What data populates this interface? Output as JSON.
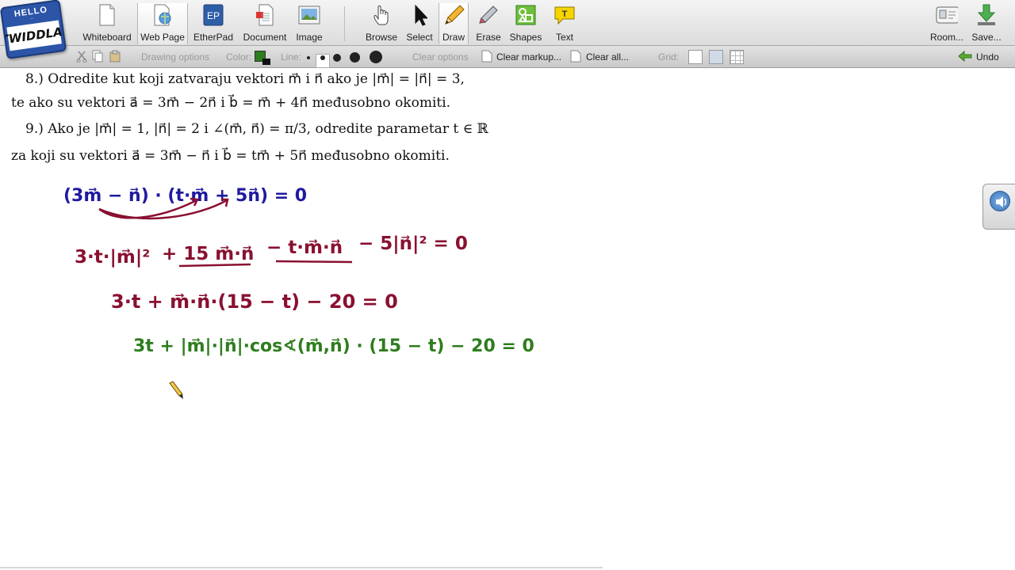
{
  "logo": {
    "hello": "HELLO",
    "name": "TWIDDLA!"
  },
  "toolbar": {
    "tools": [
      {
        "label": "Whiteboard",
        "icon": "whiteboard-icon"
      },
      {
        "label": "Web Page",
        "icon": "web-page-icon"
      },
      {
        "label": "EtherPad",
        "icon": "etherpad-icon",
        "badge": "EP"
      },
      {
        "label": "Document",
        "icon": "document-icon"
      },
      {
        "label": "Image",
        "icon": "image-icon"
      },
      {
        "label": "Browse",
        "icon": "hand-icon"
      },
      {
        "label": "Select",
        "icon": "arrow-cursor-icon"
      },
      {
        "label": "Draw",
        "icon": "pencil-icon"
      },
      {
        "label": "Erase",
        "icon": "eraser-icon"
      },
      {
        "label": "Shapes",
        "icon": "shapes-icon"
      },
      {
        "label": "Text",
        "icon": "text-icon",
        "badge": "T"
      },
      {
        "label": "Room...",
        "icon": "room-icon"
      },
      {
        "label": "Save...",
        "icon": "save-icon"
      }
    ],
    "active_tools": [
      "Web Page",
      "Draw"
    ]
  },
  "options": {
    "drawing_options": "Drawing options",
    "color_label": "Color:",
    "current_color": "#2e7d1e",
    "line_label": "Line:",
    "clear_options": "Clear options",
    "clear_markup": "Clear markup...",
    "clear_all": "Clear all...",
    "grid_label": "Grid:",
    "undo": "Undo"
  },
  "problems": {
    "p8_line1": "8.)  Odredite kut koji zatvaraju vektori m⃗ i n⃗ ako je |m⃗| = |n⃗| = 3,",
    "p8_line2": "te ako su vektori a⃗ = 3m⃗ − 2n⃗ i b⃗ = m⃗ + 4n⃗ međusobno okomiti.",
    "p9_line1": "9.)  Ako je |m⃗| = 1, |n⃗| = 2 i ∠(m⃗, n⃗) = π/3, odredite parametar t ∈ ℝ",
    "p9_line2": "za koji su vektori a⃗ = 3m⃗ − n⃗ i b⃗ = tm⃗ + 5n⃗ međusobno okomiti."
  },
  "handwriting": {
    "line1": "(3m⃗ − n⃗) · (t·m⃗ + 5n⃗)   = 0",
    "line2a": "3·t·|m⃗|²",
    "line2b": "+ 15 m⃗·n⃗",
    "line2c": "− t·m⃗·n⃗",
    "line2d": "− 5|n⃗|² = 0",
    "line3": "3·t  + m⃗·n⃗·(15 − t) − 20  = 0",
    "line4": "3t + |m⃗|·|n⃗|·cos∢(m⃗,n⃗) · (15 − t) − 20 = 0",
    "colors": {
      "blue": "#1f1aa0",
      "maroon": "#8a1030",
      "green": "#2e7d1e"
    }
  }
}
